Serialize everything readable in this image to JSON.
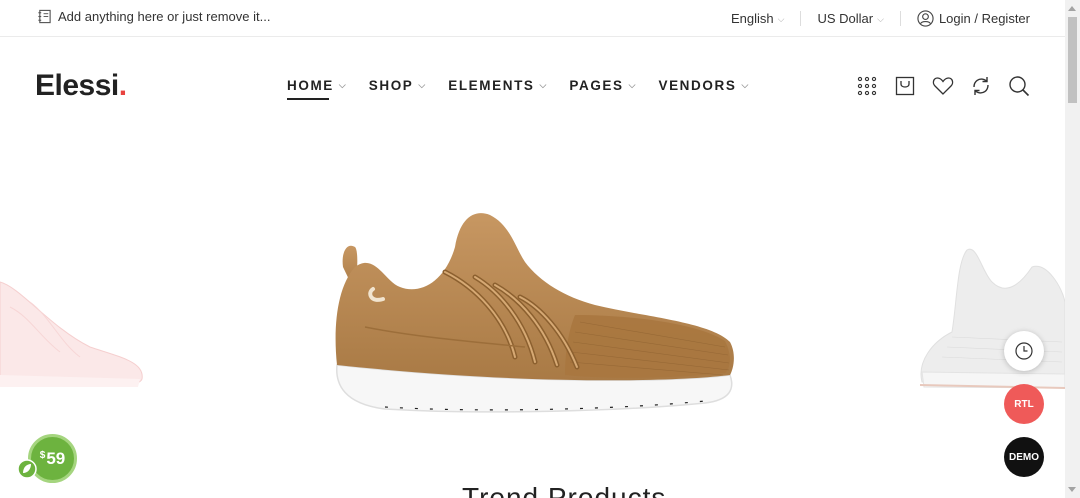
{
  "topbar": {
    "promo_text": "Add anything here or just remove it...",
    "language": "English",
    "currency": "US Dollar",
    "login_label": "Login / Register"
  },
  "header": {
    "logo_text": "Elessi",
    "logo_dot": ".",
    "nav": [
      {
        "label": "HOME"
      },
      {
        "label": "SHOP"
      },
      {
        "label": "ELEMENTS"
      },
      {
        "label": "PAGES"
      },
      {
        "label": "VENDORS"
      }
    ],
    "icons": [
      "grid-icon",
      "cart-icon",
      "heart-icon",
      "compare-icon",
      "search-icon"
    ]
  },
  "slider": {
    "section_title": "Trend Products"
  },
  "floating": {
    "rtl_label": "RTL",
    "demo_label": "DEMO",
    "price_currency": "$",
    "price_value": "59"
  },
  "colors": {
    "accent_red": "#e8423f",
    "rtl_button": "#ef5a59",
    "price_badge": "#6db33f",
    "shoe_tan": "#c18d55"
  }
}
